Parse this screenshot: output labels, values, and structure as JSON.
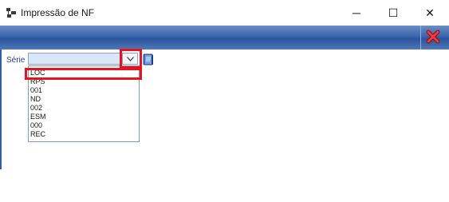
{
  "window": {
    "title": "Impressão de NF",
    "minimize_glyph": "─",
    "maximize_glyph": "☐",
    "close_glyph": "✕"
  },
  "toolbar": {
    "close_icon": "red-x-icon",
    "close_color": "#e6141e"
  },
  "form": {
    "serie_label": "Série :",
    "serie_value": "",
    "dropdown_icon": "chevron-down-icon",
    "lookup_icon": "lookup-book-icon"
  },
  "dropdown": {
    "options": [
      "LOC",
      "RPS",
      "001",
      "ND",
      "002",
      "ESM",
      "000",
      "REC"
    ]
  },
  "colors": {
    "accent": "#2c559c",
    "highlight": "#e6141e",
    "label": "#2b3f8c"
  }
}
